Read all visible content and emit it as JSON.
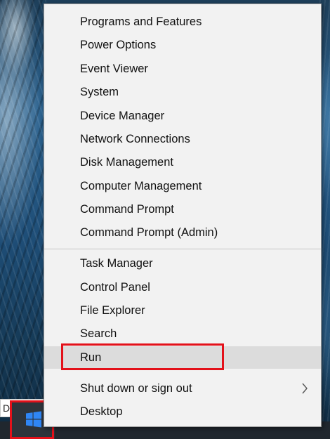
{
  "menu": {
    "group1": [
      "Programs and Features",
      "Power Options",
      "Event Viewer",
      "System",
      "Device Manager",
      "Network Connections",
      "Disk Management",
      "Computer Management",
      "Command Prompt",
      "Command Prompt (Admin)"
    ],
    "group2": [
      "Task Manager",
      "Control Panel",
      "File Explorer",
      "Search",
      "Run"
    ],
    "group3": [
      "Shut down or sign out",
      "Desktop"
    ],
    "hovered_item": "Run",
    "submenu_item": "Shut down or sign out"
  },
  "background_window": {
    "partial_text": "D"
  },
  "icons": {
    "start": "windows-logo-icon",
    "submenu": "chevron-right-icon"
  },
  "colors": {
    "menu_background": "#f2f2f2",
    "hover_background": "#dcdcdc",
    "highlight_annotation": "#e3111a",
    "windows_logo": "#2f86f5",
    "taskbar": "#20272e"
  }
}
